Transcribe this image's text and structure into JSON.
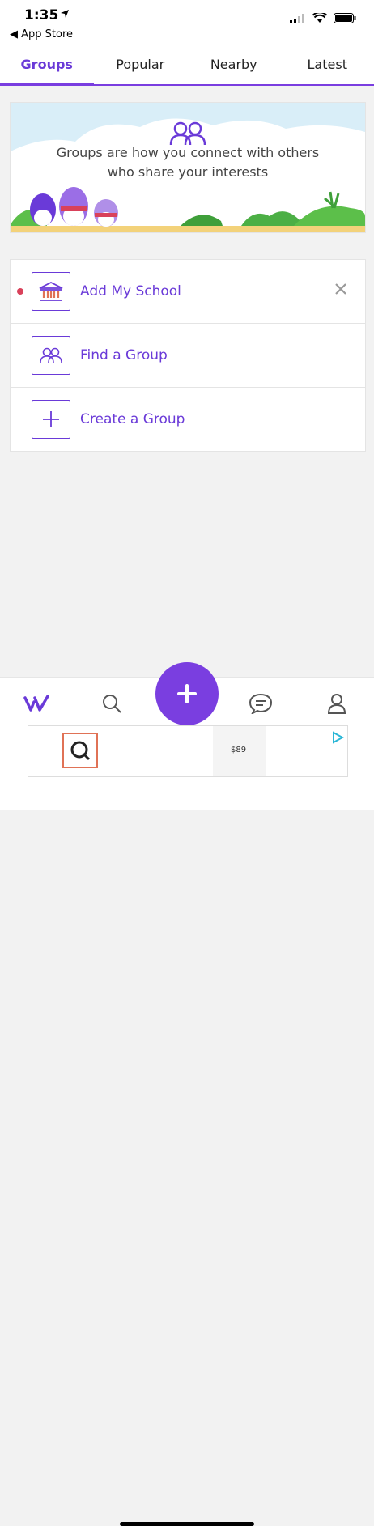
{
  "status_bar": {
    "time": "1:35",
    "back_label": "◀ App Store"
  },
  "tabs": [
    {
      "label": "Groups",
      "active": true
    },
    {
      "label": "Popular",
      "active": false
    },
    {
      "label": "Nearby",
      "active": false
    },
    {
      "label": "Latest",
      "active": false
    }
  ],
  "banner": {
    "line1": "Groups are how you connect with others",
    "line2": "who share your interests"
  },
  "actions": [
    {
      "label": "Add My School",
      "icon": "school-building-icon",
      "has_dot": true,
      "dismissible": true
    },
    {
      "label": "Find a Group",
      "icon": "people-icon",
      "has_dot": false,
      "dismissible": false
    },
    {
      "label": "Create a Group",
      "icon": "plus-icon",
      "has_dot": false,
      "dismissible": false
    }
  ],
  "bottom_nav": [
    "home-logo-icon",
    "search-icon",
    "compose-plus-icon",
    "chat-icon",
    "profile-icon"
  ],
  "ad": {
    "price": "$89"
  },
  "colors": {
    "accent": "#7a3ee0",
    "dot": "#d9415a"
  }
}
